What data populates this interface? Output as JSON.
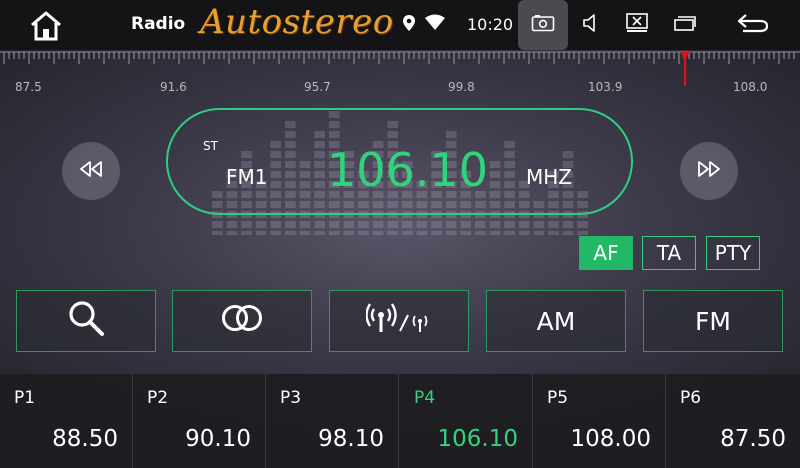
{
  "status_bar": {
    "title": "Radio",
    "logo": "Autostereo",
    "time": "10:20",
    "icons": [
      "home-icon",
      "location-icon",
      "wifi-icon",
      "screenshot-icon",
      "volume-icon",
      "close-window-icon",
      "recent-apps-icon",
      "back-icon"
    ]
  },
  "scale": {
    "labels": [
      "87.5",
      "91.6",
      "95.7",
      "99.8",
      "103.9",
      "108.0"
    ],
    "min": 87.5,
    "max": 108.0,
    "indicator_value": 106.1,
    "indicator_color": "#e0101a"
  },
  "tuner": {
    "stereo": "ST",
    "band": "FM1",
    "frequency": "106.10",
    "unit": "MHZ",
    "accent": "#2fd47d"
  },
  "flags": {
    "af": "AF",
    "ta": "TA",
    "pty": "PTY",
    "af_active": true
  },
  "functions": {
    "search_icon": "search-icon",
    "stereo_icon": "stereo-rings-icon",
    "signal_icon": "local-distance-signal-icon",
    "am": "AM",
    "fm": "FM"
  },
  "presets": [
    {
      "name": "P1",
      "freq": "88.50",
      "active": false
    },
    {
      "name": "P2",
      "freq": "90.10",
      "active": false
    },
    {
      "name": "P3",
      "freq": "98.10",
      "active": false
    },
    {
      "name": "P4",
      "freq": "106.10",
      "active": true
    },
    {
      "name": "P5",
      "freq": "108.00",
      "active": false
    },
    {
      "name": "P6",
      "freq": "87.50",
      "active": false
    }
  ]
}
